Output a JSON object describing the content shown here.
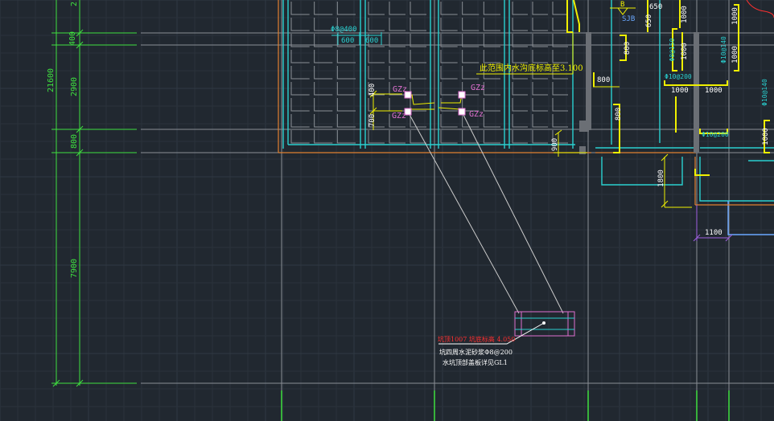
{
  "colors": {
    "background": "#212830",
    "grid_minor": "#2a323b",
    "grid_major": "#303943",
    "dimension_green": "#3fe03f",
    "yellow": "#f0f000",
    "cyan": "#2ad0d0",
    "white": "#e8e8e8",
    "gray": "#8a8f96",
    "orange": "#e08030",
    "magenta": "#e070d0",
    "red": "#ff3030",
    "purple": "#a060e0",
    "blue_light": "#6aa8ff"
  },
  "left_dimensions": {
    "total": "21600",
    "d_top": "2",
    "d400": "400",
    "d2900": "2900",
    "d800": "800",
    "d7900": "7900"
  },
  "column_labels": {
    "gz_tl": "GZz",
    "gz_bl": "GZz",
    "gz_tr": "GZz",
    "gz_br": "GZz"
  },
  "local_dims": {
    "d400_v": "400",
    "d700_v": "700",
    "d900_v": "900",
    "d600_a": "600",
    "d600_b": "600",
    "rebar_top": "Φ8@400"
  },
  "notes": {
    "slab_note": "此范围内水沟底标高至3.100",
    "callout_line1": "坑顶1007 坑底标高 4.050",
    "callout_line2": "坑四周水泥砂浆Φ8@200",
    "callout_line3": "水坑顶部盖板详见GL1"
  },
  "right_area": {
    "marker_letter": "B",
    "marker_label": "SJB",
    "dim_650_a": "650",
    "dim_650_b": "650",
    "dim_1000_a": "1000",
    "dim_1000_b": "1000",
    "dim_1000_c": "1000",
    "dim_1000_d": "1000",
    "dim_1000_e": "1000",
    "dim_800_a": "800",
    "dim_800_b": "800",
    "dim_800_c": "800",
    "dim_1800": "1800",
    "dim_1100": "1100",
    "rebar_a": "Φ8@150",
    "rebar_b": "Φ10@140",
    "rebar_c": "Φ10@200",
    "rebar_d": "Φ10@200",
    "rebar_e": "Φ10@140",
    "dim_1000_h1": "1000",
    "dim_1000_h2": "1000"
  }
}
